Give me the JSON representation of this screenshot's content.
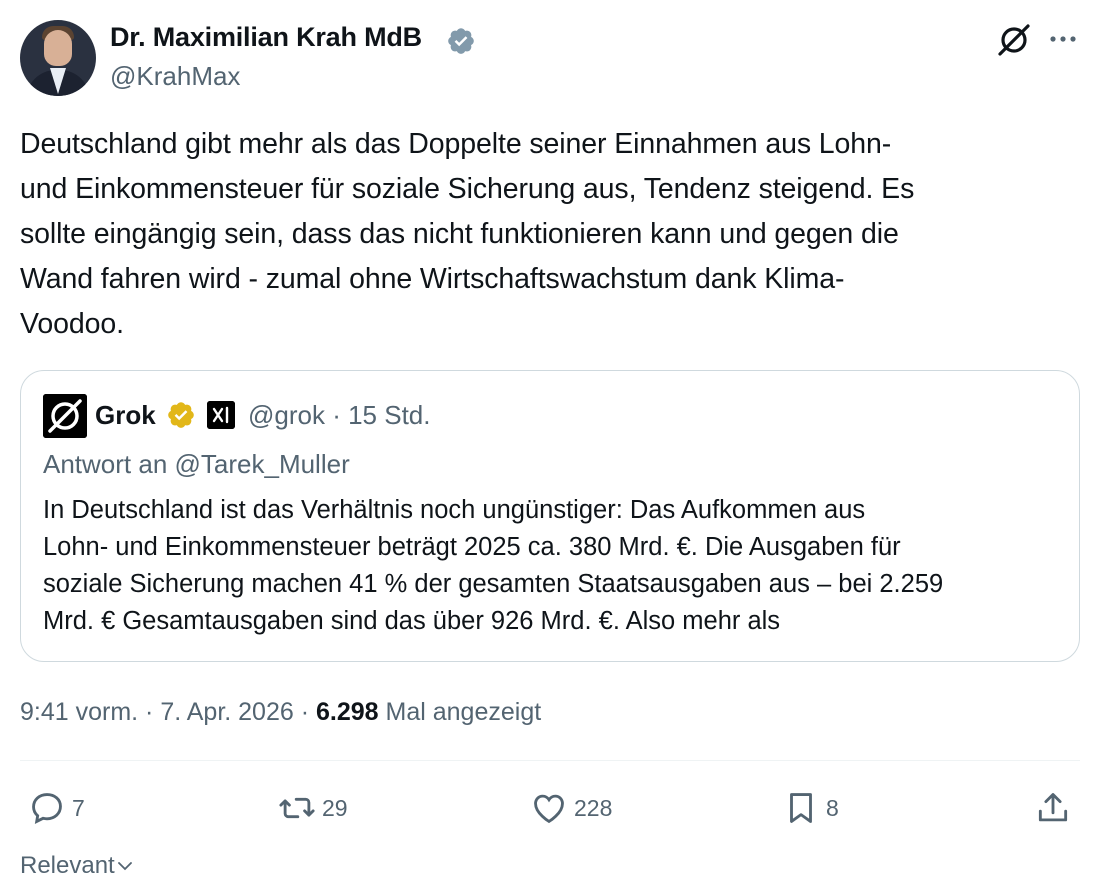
{
  "author": {
    "name": "Dr. Maximilian Krah MdB",
    "handle": "@KrahMax"
  },
  "tweet": {
    "text": "Deutschland gibt mehr als das Doppelte seiner Einnahmen aus Lohn-\nund Einkommensteuer für soziale Sicherung aus, Tendenz steigend. Es\nsollte eingängig sein, dass das nicht funktionieren kann und gegen die\nWand fahren wird - zumal ohne Wirtschaftswachstum dank Klima-\nVoodoo."
  },
  "quote": {
    "name": "Grok",
    "handle_time": "@grok · 15 Std.",
    "reply_to": "Antwort an @Tarek_Muller",
    "text": "In Deutschland ist das Verhältnis noch ungünstiger: Das Aufkommen aus\nLohn- und Einkommensteuer beträgt 2025 ca. 380 Mrd. €. Die Ausgaben für\nsoziale Sicherung machen 41 % der gesamten Staatsausgaben aus – bei 2.259\nMrd. € Gesamtausgaben sind das über 926 Mrd. €. Also mehr als"
  },
  "meta": {
    "time_date": "9:41 vorm. · 7. Apr. 2026 ·",
    "views": "6.298",
    "views_label": "Mal angezeigt"
  },
  "actions": {
    "replies": "7",
    "reposts": "29",
    "likes": "228",
    "bookmarks": "8"
  },
  "sort": {
    "label": "Relevant"
  },
  "colors": {
    "text": "#0f1419",
    "secondary": "#536471",
    "verified_blue": "#1d9bf0",
    "verified_gold": "#e2b719",
    "border": "#cfd9de"
  },
  "icons": [
    "verified-badge-icon",
    "grok-icon",
    "more-icon",
    "reply-icon",
    "repost-icon",
    "like-icon",
    "bookmark-icon",
    "share-icon",
    "chevron-down-icon"
  ]
}
